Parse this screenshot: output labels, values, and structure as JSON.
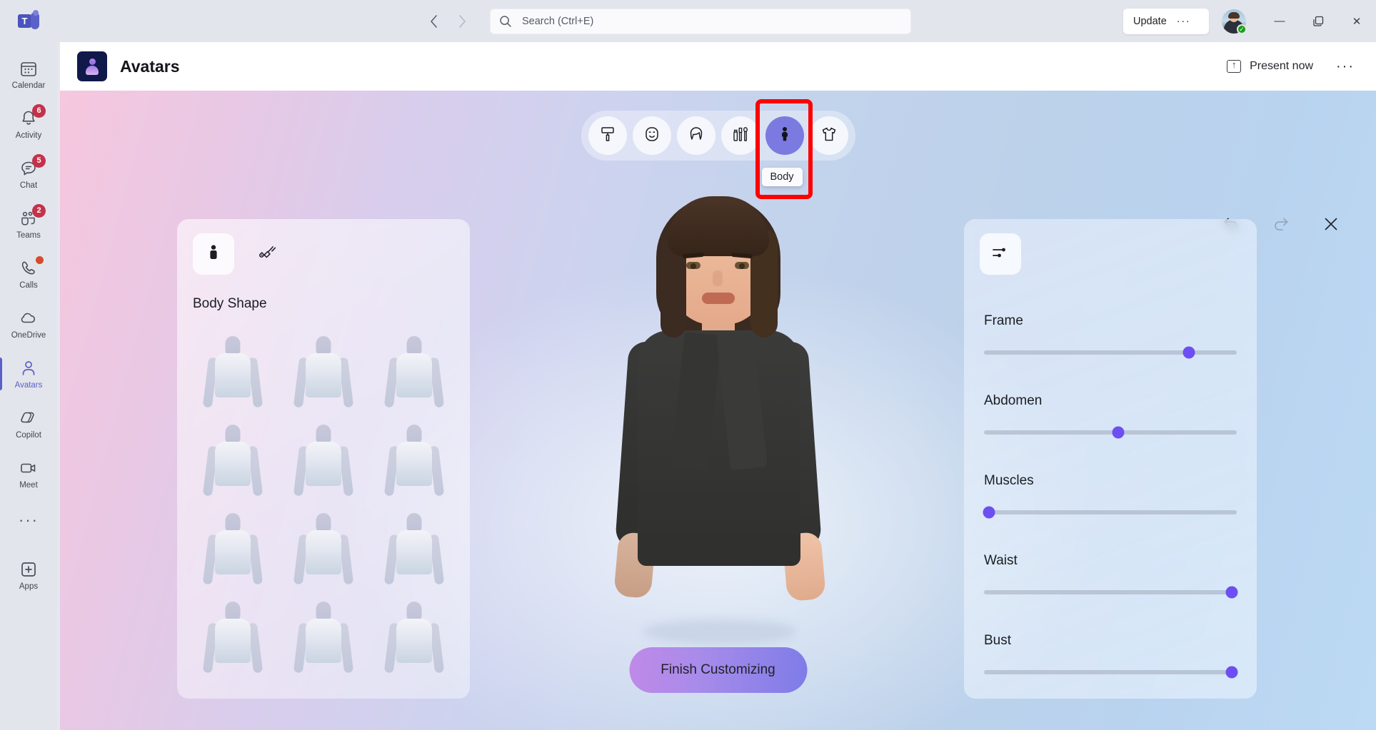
{
  "titlebar": {
    "back_icon": "chevron-left-icon",
    "forward_icon": "chevron-right-icon",
    "search_placeholder": "Search (Ctrl+E)",
    "update_label": "Update",
    "update_overflow": "···",
    "presence_status": "available",
    "minimize": "—",
    "maximize": "❐",
    "close": "✕"
  },
  "rail": {
    "items": [
      {
        "label": "Calendar",
        "icon": "calendar-icon",
        "badge": "",
        "dot": false,
        "active": false
      },
      {
        "label": "Activity",
        "icon": "bell-icon",
        "badge": "6",
        "dot": false,
        "active": false
      },
      {
        "label": "Chat",
        "icon": "chat-icon",
        "badge": "5",
        "dot": false,
        "active": false
      },
      {
        "label": "Teams",
        "icon": "teams-icon",
        "badge": "2",
        "dot": false,
        "active": false
      },
      {
        "label": "Calls",
        "icon": "phone-icon",
        "badge": "",
        "dot": true,
        "active": false
      },
      {
        "label": "OneDrive",
        "icon": "cloud-icon",
        "badge": "",
        "dot": false,
        "active": false
      },
      {
        "label": "Avatars",
        "icon": "person-icon",
        "badge": "",
        "dot": false,
        "active": true
      },
      {
        "label": "Copilot",
        "icon": "copilot-icon",
        "badge": "",
        "dot": false,
        "active": false
      },
      {
        "label": "Meet",
        "icon": "video-camera-icon",
        "badge": "",
        "dot": false,
        "active": false
      }
    ],
    "more_label": "···",
    "apps_label": "Apps",
    "apps_icon": "plus-square-icon"
  },
  "app_header": {
    "title": "Avatars",
    "app_icon": "avatars-app-icon",
    "present_label": "Present now",
    "present_icon": "share-screen-icon",
    "overflow_label": "···"
  },
  "stage": {
    "categories": [
      {
        "name": "style",
        "icon": "paintbrush-icon",
        "active": false
      },
      {
        "name": "face",
        "icon": "face-icon",
        "active": false
      },
      {
        "name": "hair",
        "icon": "hair-icon",
        "active": false
      },
      {
        "name": "makeup",
        "icon": "makeup-icon",
        "active": false
      },
      {
        "name": "body",
        "icon": "body-icon",
        "active": true
      },
      {
        "name": "clothing",
        "icon": "tshirt-icon",
        "active": false
      }
    ],
    "tooltip": "Body",
    "highlight_color": "#ff0000",
    "accent_color": "#7b7ae0",
    "actions": [
      {
        "name": "undo",
        "icon": "undo-icon",
        "disabled": false
      },
      {
        "name": "redo",
        "icon": "redo-icon",
        "disabled": true
      },
      {
        "name": "close",
        "icon": "close-icon",
        "disabled": false
      }
    ],
    "finish_button": "Finish Customizing"
  },
  "left_panel": {
    "tabs": [
      {
        "name": "body-shape",
        "icon": "body-shape-icon",
        "active": true
      },
      {
        "name": "prosthetics",
        "icon": "prosthetic-arm-icon",
        "active": false
      }
    ],
    "section_title": "Body Shape",
    "shape_count": 12
  },
  "right_panel": {
    "tabs": [
      {
        "name": "sliders",
        "icon": "sliders-icon",
        "active": true
      }
    ],
    "sliders": [
      {
        "label": "Frame",
        "value": 81
      },
      {
        "label": "Abdomen",
        "value": 53
      },
      {
        "label": "Muscles",
        "value": 2
      },
      {
        "label": "Waist",
        "value": 98
      },
      {
        "label": "Bust",
        "value": 98
      }
    ],
    "slider_accent": "#6c4ff2"
  }
}
